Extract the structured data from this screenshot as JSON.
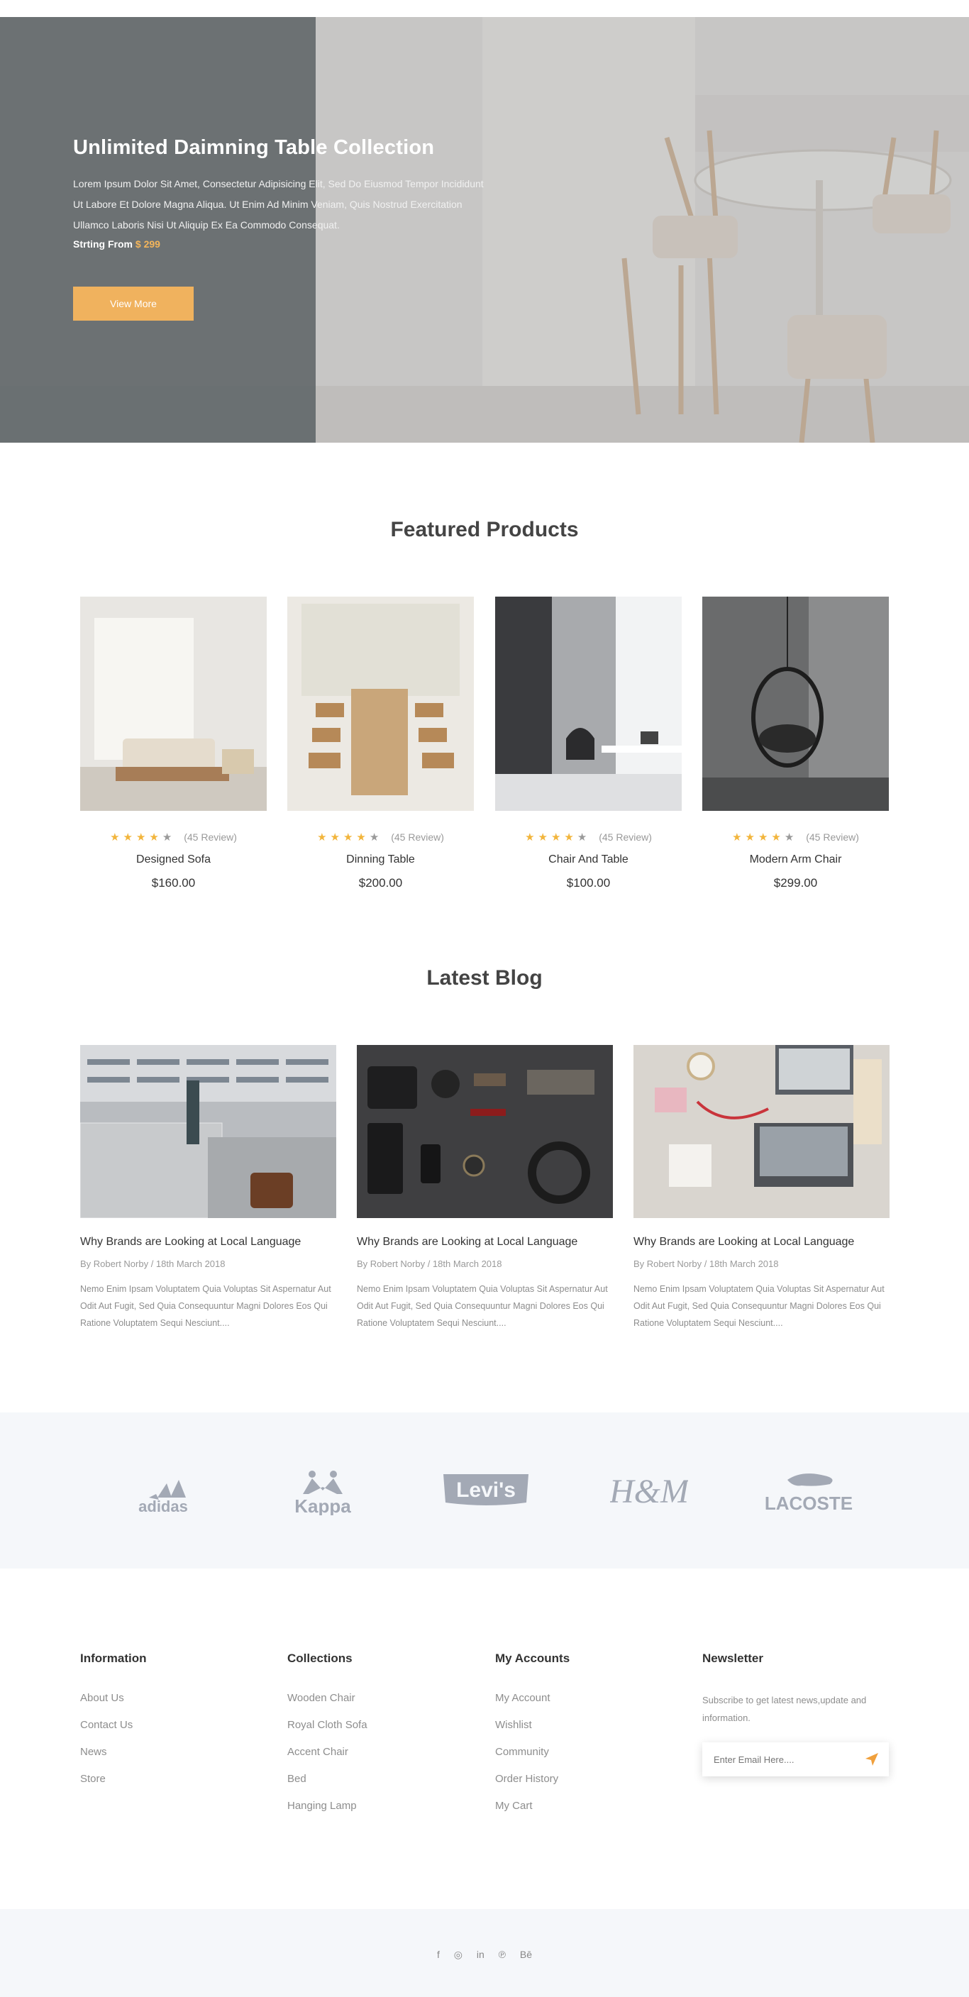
{
  "hero": {
    "title": "Unlimited Daimning Table Collection",
    "description": "Lorem Ipsum Dolor Sit Amet, Consectetur Adipisicing Elit, Sed Do Eiusmod Tempor Incididunt Ut Labore Et Dolore Magna Aliqua. Ut Enim Ad Minim Veniam, Quis Nostrud Exercitation Ullamco Laboris Nisi Ut Aliquip Ex Ea Commodo Consequat.",
    "price_label": "Strting From",
    "price_value": "$ 299",
    "button_label": "View More"
  },
  "featured": {
    "title": "Featured Products",
    "products": [
      {
        "name": "Designed Sofa",
        "price": "$160.00",
        "reviews": "(45 Review)",
        "stars": 4
      },
      {
        "name": "Dinning Table",
        "price": "$200.00",
        "reviews": "(45 Review)",
        "stars": 4
      },
      {
        "name": "Chair And Table",
        "price": "$100.00",
        "reviews": "(45 Review)",
        "stars": 4
      },
      {
        "name": "Modern Arm Chair",
        "price": "$299.00",
        "reviews": "(45 Review)",
        "stars": 4
      }
    ]
  },
  "blog": {
    "title": "Latest Blog",
    "posts": [
      {
        "title": "Why Brands are Looking at Local Language",
        "meta": "By Robert Norby / 18th March 2018",
        "excerpt": "Nemo Enim Ipsam Voluptatem Quia Voluptas Sit Aspernatur Aut Odit Aut Fugit, Sed Quia Consequuntur Magni Dolores Eos Qui Ratione Voluptatem Sequi Nesciunt...."
      },
      {
        "title": "Why Brands are Looking at Local Language",
        "meta": "By Robert Norby / 18th March 2018",
        "excerpt": "Nemo Enim Ipsam Voluptatem Quia Voluptas Sit Aspernatur Aut Odit Aut Fugit, Sed Quia Consequuntur Magni Dolores Eos Qui Ratione Voluptatem Sequi Nesciunt...."
      },
      {
        "title": "Why Brands are Looking at Local Language",
        "meta": "By Robert Norby / 18th March 2018",
        "excerpt": "Nemo Enim Ipsam Voluptatem Quia Voluptas Sit Aspernatur Aut Odit Aut Fugit, Sed Quia Consequuntur Magni Dolores Eos Qui Ratione Voluptatem Sequi Nesciunt...."
      }
    ]
  },
  "brands": [
    "adidas",
    "Kappa",
    "Levi's",
    "H&M",
    "LACOSTE"
  ],
  "footer": {
    "information": {
      "title": "Information",
      "links": [
        "About Us",
        "Contact Us",
        "News",
        "Store"
      ]
    },
    "collections": {
      "title": "Collections",
      "links": [
        "Wooden Chair",
        "Royal Cloth Sofa",
        "Accent Chair",
        "Bed",
        "Hanging Lamp"
      ]
    },
    "accounts": {
      "title": "My Accounts",
      "links": [
        "My Account",
        "Wishlist",
        "Community",
        "Order History",
        "My Cart"
      ]
    },
    "newsletter": {
      "title": "Newsletter",
      "text": "Subscribe to get latest news,update and information.",
      "placeholder": "Enter Email Here...."
    },
    "social": [
      "f",
      "◎",
      "in",
      "℗",
      "Bē"
    ]
  },
  "colors": {
    "accent": "#f0b25e",
    "star": "#f2b53c",
    "brand_gray": "#a3a9b5",
    "light_bg": "#f5f7fa"
  }
}
